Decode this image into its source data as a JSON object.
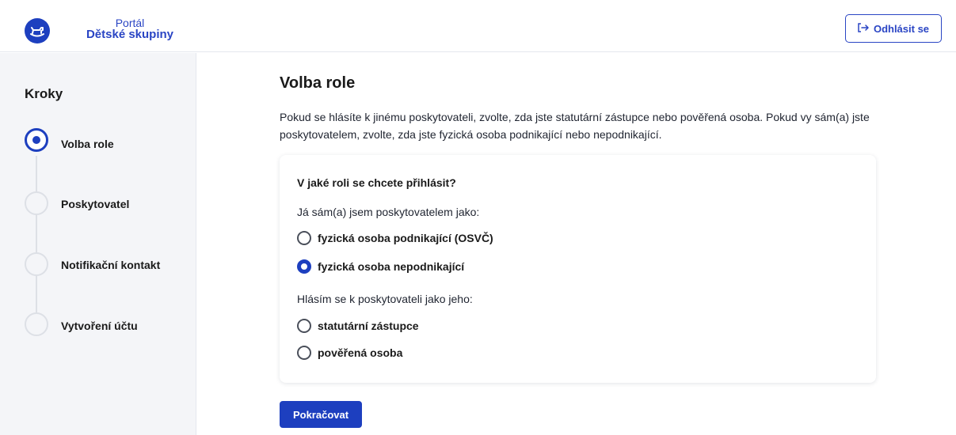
{
  "header": {
    "brand_small": "Portál",
    "brand_big": "Dětské skupiny",
    "logout_label": "Odhlásit se",
    "logo_icon": "rocking-horse-icon",
    "logout_icon": "logout-arrow-icon"
  },
  "sidebar": {
    "title": "Kroky",
    "steps": [
      {
        "label": "Volba role",
        "state": "active"
      },
      {
        "label": "Poskytovatel",
        "state": "inactive"
      },
      {
        "label": "Notifikační kontakt",
        "state": "inactive"
      },
      {
        "label": "Vytvoření účtu",
        "state": "inactive"
      }
    ]
  },
  "main": {
    "title": "Volba role",
    "intro": "Pokud se hlásíte k jinému poskytovateli, zvolte, zda jste statutární zástupce nebo pověřená osoba. Pokud vy sám(a) jste poskytovatelem, zvolte, zda jste fyzická osoba podnikající nebo nepodnikající.",
    "question": "V jaké roli se chcete přihlásit?",
    "groups": [
      {
        "label": "Já sám(a) jsem poskytovatelem jako:",
        "options": [
          {
            "label": "fyzická osoba podnikající (OSVČ)",
            "checked": false
          },
          {
            "label": "fyzická osoba nepodnikající",
            "checked": true
          }
        ]
      },
      {
        "label": "Hlásím se k poskytovateli jako jeho:",
        "options": [
          {
            "label": "statutární zástupce",
            "checked": false
          },
          {
            "label": "pověřená osoba",
            "checked": false
          }
        ]
      }
    ],
    "continue_label": "Pokračovat"
  },
  "colors": {
    "primary": "#1d3fbf",
    "sidebar_bg": "#f4f5f8"
  }
}
